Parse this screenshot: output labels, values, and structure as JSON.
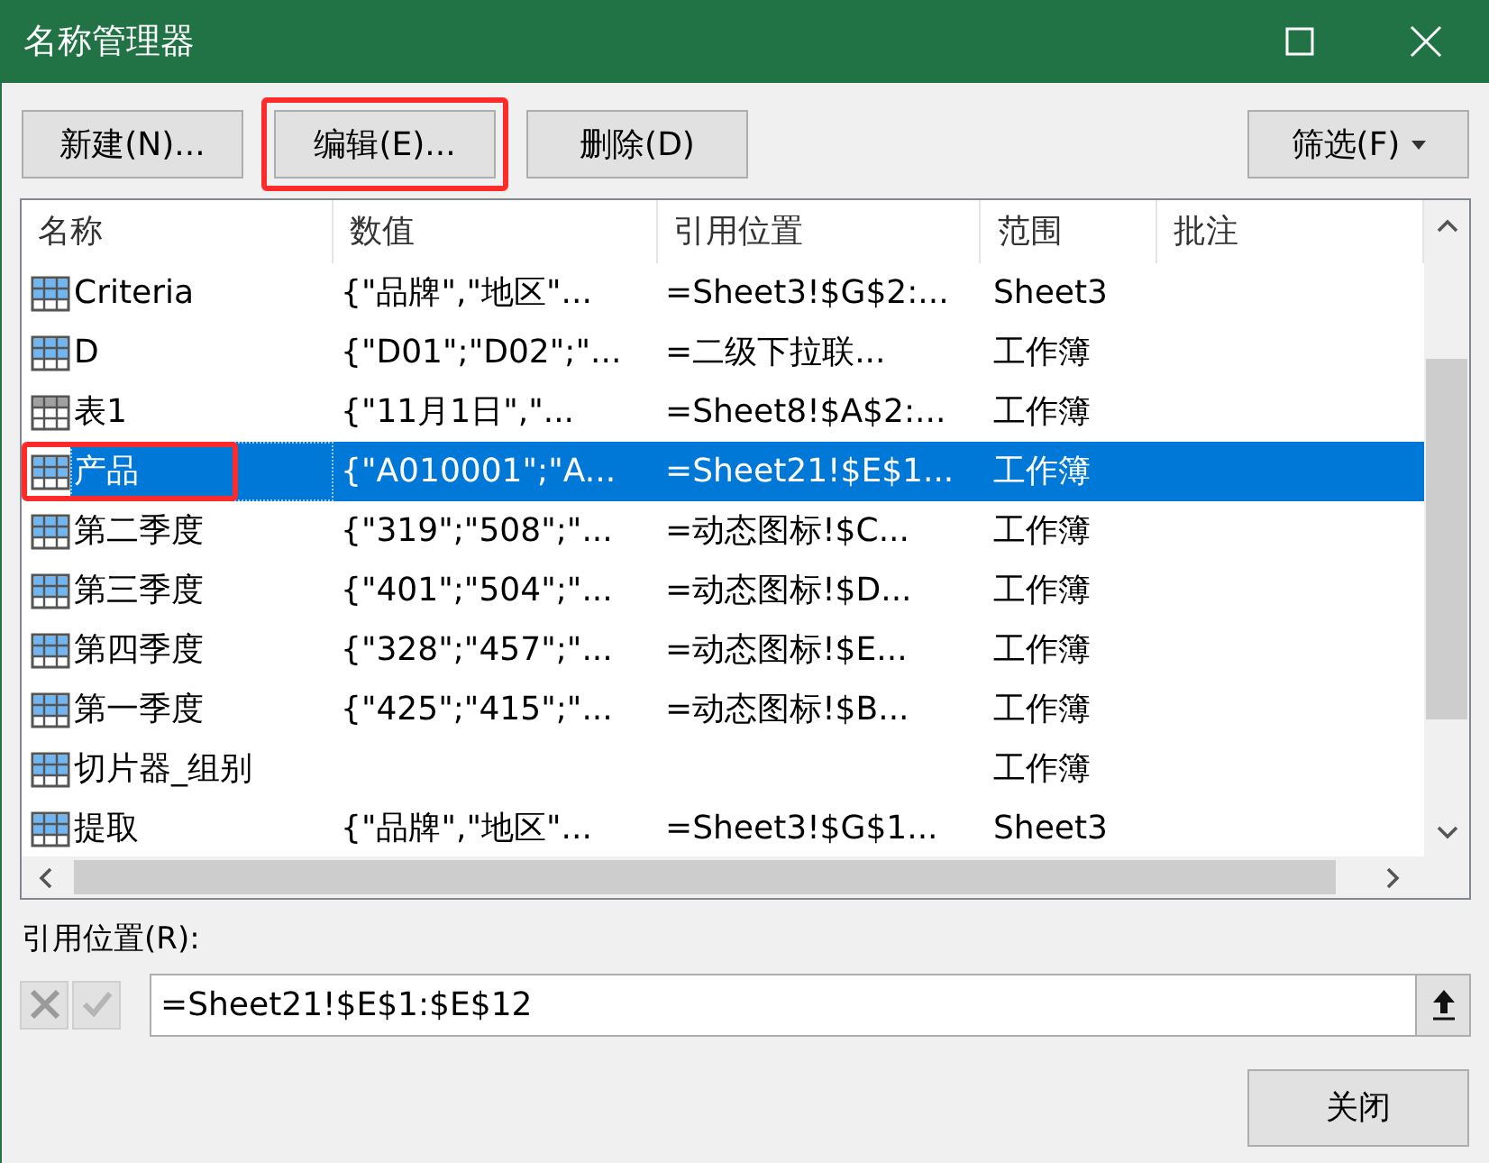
{
  "window": {
    "title": "名称管理器"
  },
  "toolbar": [
    {
      "label": "新建(N)...",
      "highlighted": false
    },
    {
      "label": "编辑(E)...",
      "highlighted": true
    },
    {
      "label": "删除(D)",
      "highlighted": false
    }
  ],
  "filter_button": {
    "label": "筛选(F)"
  },
  "table": {
    "columns": [
      "名称",
      "数值",
      "引用位置",
      "范围",
      "批注"
    ],
    "rows": [
      {
        "kind": "name",
        "name": "Criteria",
        "value": "{\"品牌\",\"地区\"...",
        "refers_to": "=Sheet3!$G$2:...",
        "scope": "Sheet3",
        "selected": false,
        "highlighted": false
      },
      {
        "kind": "name",
        "name": "D",
        "value": "{\"D01\";\"D02\";\"...",
        "refers_to": "=二级下拉联...",
        "scope": "工作簿",
        "selected": false,
        "highlighted": false
      },
      {
        "kind": "table",
        "name": "表1",
        "value": "{\"11月1日\",\"...",
        "refers_to": "=Sheet8!$A$2:...",
        "scope": "工作簿",
        "selected": false,
        "highlighted": false
      },
      {
        "kind": "name",
        "name": "产品",
        "value": "{\"A010001\";\"A...",
        "refers_to": "=Sheet21!$E$1...",
        "scope": "工作簿",
        "selected": true,
        "highlighted": true
      },
      {
        "kind": "name",
        "name": "第二季度",
        "value": "{\"319\";\"508\";\"...",
        "refers_to": "=动态图标!$C...",
        "scope": "工作簿",
        "selected": false,
        "highlighted": false
      },
      {
        "kind": "name",
        "name": "第三季度",
        "value": "{\"401\";\"504\";\"...",
        "refers_to": "=动态图标!$D...",
        "scope": "工作簿",
        "selected": false,
        "highlighted": false
      },
      {
        "kind": "name",
        "name": "第四季度",
        "value": "{\"328\";\"457\";\"...",
        "refers_to": "=动态图标!$E...",
        "scope": "工作簿",
        "selected": false,
        "highlighted": false
      },
      {
        "kind": "name",
        "name": "第一季度",
        "value": "{\"425\";\"415\";\"...",
        "refers_to": "=动态图标!$B...",
        "scope": "工作簿",
        "selected": false,
        "highlighted": false
      },
      {
        "kind": "name",
        "name": "切片器_组别",
        "refers_to": "",
        "scope": "工作簿",
        "selected": false,
        "highlighted": false
      },
      {
        "kind": "name",
        "name": "提取",
        "value": "{\"品牌\",\"地区\"...",
        "refers_to": "=Sheet3!$G$1...",
        "scope": "Sheet3",
        "selected": false,
        "highlighted": false
      }
    ]
  },
  "refers_to_field": {
    "label": "引用位置(R):",
    "value": "=Sheet21!$E$1:$E$12"
  },
  "close_button": {
    "label": "关闭"
  }
}
